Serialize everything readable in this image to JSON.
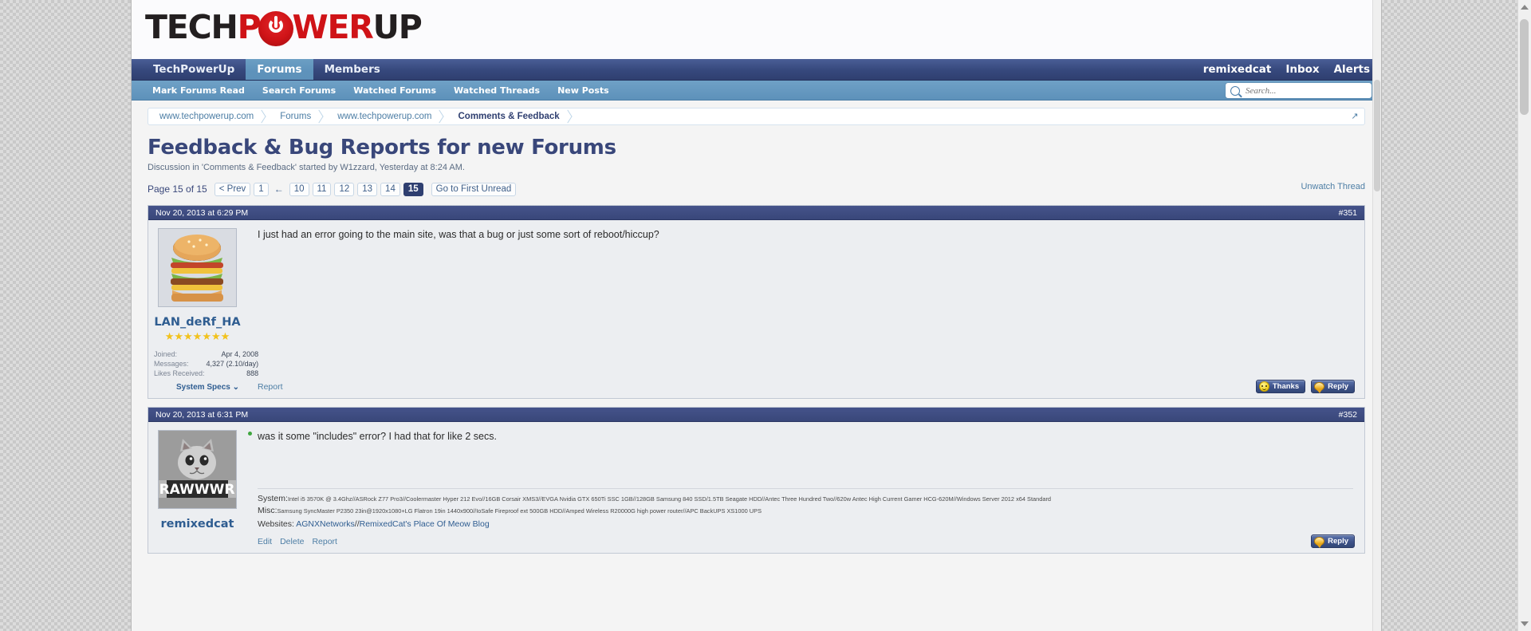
{
  "site": {
    "logo_text_1": "TECH",
    "logo_text_2": "P",
    "logo_text_3": "WER",
    "logo_text_4": "UP"
  },
  "nav_primary": {
    "tabs": [
      {
        "label": "TechPowerUp",
        "active": false
      },
      {
        "label": "Forums",
        "active": true
      },
      {
        "label": "Members",
        "active": false
      }
    ],
    "right": [
      {
        "label": "remixedcat"
      },
      {
        "label": "Inbox"
      },
      {
        "label": "Alerts"
      }
    ]
  },
  "nav_secondary": {
    "links": [
      {
        "label": "Mark Forums Read"
      },
      {
        "label": "Search Forums"
      },
      {
        "label": "Watched Forums"
      },
      {
        "label": "Watched Threads"
      },
      {
        "label": "New Posts"
      }
    ],
    "search_placeholder": "Search...",
    "search_value": "",
    "search_icon": "search-icon"
  },
  "breadcrumb": {
    "items": [
      {
        "label": "www.techpowerup.com",
        "current": false
      },
      {
        "label": "Forums",
        "current": false
      },
      {
        "label": "www.techpowerup.com",
        "current": false
      },
      {
        "label": "Comments & Feedback",
        "current": true
      }
    ],
    "expand_icon": "expand-arrow-icon"
  },
  "thread": {
    "title": "Feedback & Bug Reports for new Forums",
    "subtitle": "Discussion in 'Comments & Feedback' started by W1zzard, Yesterday at 8:24 AM.",
    "unwatch_label": "Unwatch Thread"
  },
  "pagenav": {
    "page_label": "Page 15 of 15",
    "prev_label": "< Prev",
    "first_page": "1",
    "gap_icon": "left-arrow-icon",
    "pages": [
      "10",
      "11",
      "12",
      "13",
      "14",
      "15"
    ],
    "active_page": "15",
    "first_unread_label": "Go to First Unread"
  },
  "posts": [
    {
      "timestamp": "Nov 20, 2013 at 6:29 PM",
      "post_number": "#351",
      "avatar_name": "burger-avatar",
      "username": "LAN_deRf_HA",
      "stars": 7,
      "online": false,
      "stats": [
        {
          "key": "Joined:",
          "value": "Apr 4, 2008"
        },
        {
          "key": "Messages:",
          "value": "4,327 (2.10/day)"
        },
        {
          "key": "Likes Received:",
          "value": "888"
        }
      ],
      "system_specs_label": "System Specs",
      "body": "I just had an error going to the main site, was that a bug or just some sort of reboot/hiccup?",
      "actions": [
        "Report"
      ],
      "buttons": [
        {
          "label": "Thanks",
          "icon": "smiley-icon"
        },
        {
          "label": "Reply",
          "icon": "speech-bubble-icon"
        }
      ],
      "signature": null
    },
    {
      "timestamp": "Nov 20, 2013 at 6:31 PM",
      "post_number": "#352",
      "avatar_name": "kitten-rawwwr-avatar",
      "avatar_caption": "RAWWWR",
      "username": "remixedcat",
      "stars": 0,
      "online": true,
      "stats": [],
      "system_specs_label": "",
      "body": "was it some \"includes\" error? I had that for like 2 secs.",
      "actions": [
        "Edit",
        "Delete",
        "Report"
      ],
      "buttons": [
        {
          "label": "Reply",
          "icon": "speech-bubble-icon"
        }
      ],
      "signature": {
        "system_label": "System:",
        "system_text": "Intel i5 3570K @ 3.4Ghz//ASRock Z77 Pro3//Coolermaster Hyper 212 Evo//16GB Corsair XMS3//EVGA Nvidia GTX 650Ti SSC 1GB//128GB Samsung 840 SSD/1.5TB Seagate HDD//Antec Three Hundred Two//620w Antec High Current Gamer HCG-620M//Windows Server 2012 x64 Standard",
        "misc_label": "Misc:",
        "misc_text": "Samsung SyncMaster P2350 23in@1920x1080+LG Flatron 19in 1440x900//IoSafe Fireproof ext 500GB HDD//Amped Wireless R20000G high power router//APC BackUPS XS1000 UPS",
        "websites_label": "Websites:",
        "websites_links": [
          "AGNXNetworks",
          "RemixedCat's Place Of Meow Blog"
        ],
        "websites_separator": "//"
      }
    }
  ],
  "colors": {
    "brand_red": "#cf1317",
    "nav_blue": "#36487c",
    "sub_nav_blue": "#5d91ba",
    "link_blue": "#4d7ea5",
    "title_blue": "#39477a"
  }
}
